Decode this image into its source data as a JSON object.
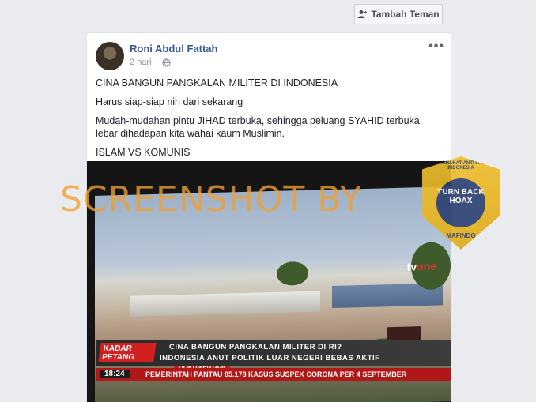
{
  "header": {
    "add_friend_label": "Tambah Teman",
    "add_friend_icon": "add-friend-icon"
  },
  "post": {
    "author": "Roni Abdul Fattah",
    "time": "2 hari",
    "privacy_icon": "globe-icon",
    "more_label": "•••",
    "paragraphs": [
      "CINA BANGUN PANGKALAN MILITER DI INDONESIA",
      "Harus siap-siap nih dari sekarang",
      "Mudah-mudahan pintu JIHAD terbuka, sehingga peluang SYAHID terbuka lebar dihadapan kita wahai kaum Muslimin.",
      "ISLAM VS KOMUNIS"
    ]
  },
  "photo": {
    "channel_logo": "tv",
    "channel_logo_accent": "one",
    "doc_label": "DOKUMENTASI",
    "program": "KABAR PETANG",
    "headline_1": "CINA BANGUN PANGKALAN MILITER DI RI?",
    "headline_2": "INDONESIA ANUT POLITIK LUAR NEGERI BEBAS AKTIF",
    "clock": "18:24",
    "crawl": "PEMERINTAH PANTAU 85.178 KASUS SUSPEK CORONA PER 4 SEPTEMBER"
  },
  "overlay": {
    "watermark": "SCREENSHOT BY",
    "seal_top": "MASYARAKAT ANTI FITNAH INDONESIA",
    "seal_center": "TURN BACK HOAX",
    "seal_bottom": "MAFINDO",
    "seal_color": "#f1c231",
    "watermark_color": "#f0a030"
  }
}
